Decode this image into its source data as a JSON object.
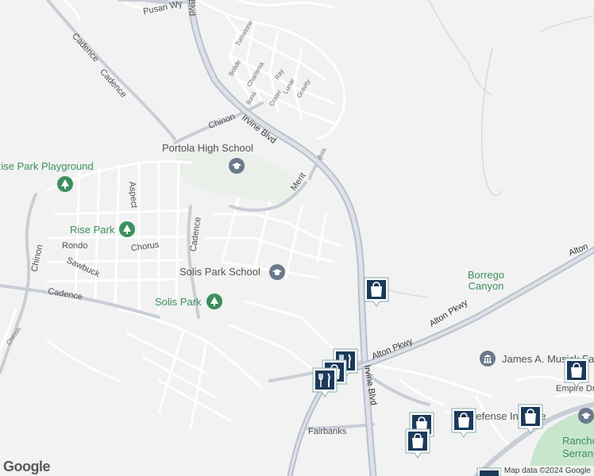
{
  "map": {
    "attribution": "Map data ©2024 Google",
    "logo": "Google",
    "roads": {
      "irvine_blvd_north": "Irvine Blvd",
      "irvine_blvd_south": "Irvine Blvd",
      "pusan_wy": "Pusan Wy",
      "cadence_nw": "Cadence",
      "cadence_mid": "Cadence",
      "cadence_west": "Cadence",
      "cadence_vertical": "Cadence",
      "chinon_north": "Chinon",
      "chinon_west": "Chinon",
      "chinon_sw": "Chinon",
      "aspect": "Aspect",
      "rondo": "Rondo",
      "sawbuck": "Sawbuck",
      "chorus": "Chorus",
      "merit": "Merit",
      "axis": "Axis",
      "turnstone": "Turnstone",
      "bolide": "Bolide",
      "charisma": "Charisma",
      "ray": "Ray",
      "iluna": "Iluna",
      "crater": "Crater",
      "lunar": "Lunar",
      "gravity": "Gravity",
      "alton_pkwy_1": "Alton Pkwy",
      "alton_pkwy_2": "Alton Pkwy",
      "alton_pkwy_3": "Alton",
      "fairbanks": "Fairbanks",
      "empire_dr": "Empire Dr",
      "blvd_top": "Blvd"
    },
    "places": {
      "portola_high": "Portola High School",
      "rise_park_playground": "Rise Park Playground",
      "rise_park": "Rise Park",
      "solis_park_school": "Solis Park School",
      "solis_park": "Solis Park",
      "borrego_canyon": "Borrego Canyon",
      "james_museum": "James A. Musick Fa",
      "defense_institute": "Defense Institute",
      "rancho_serrano": "Rancho Serrano"
    }
  }
}
